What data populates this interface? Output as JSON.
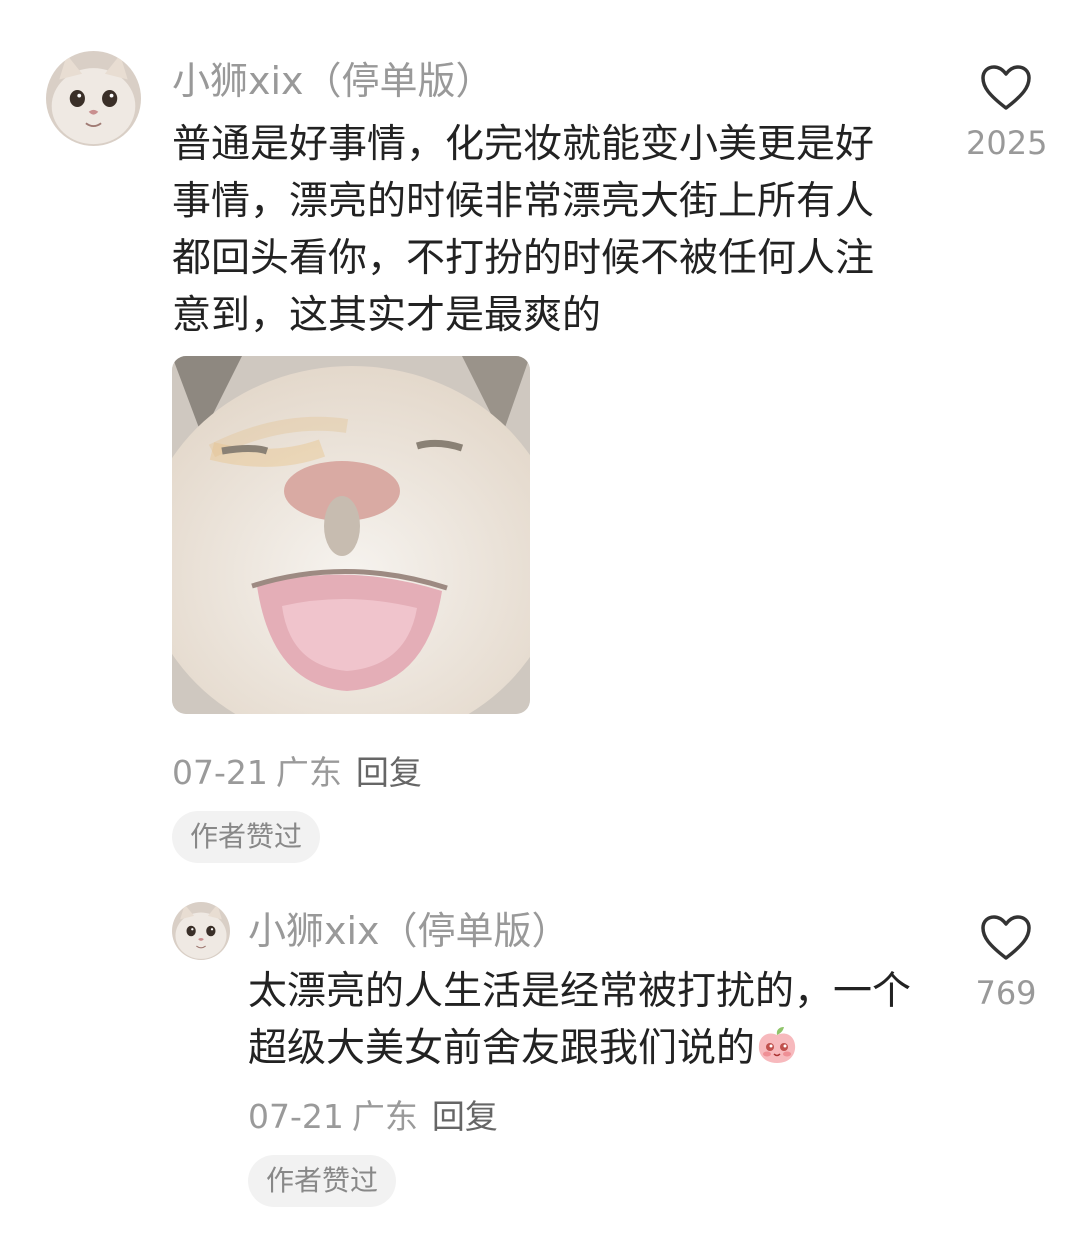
{
  "comments": [
    {
      "username": "小狮xix（停单版）",
      "text": "普通是好事情，化完妆就能变小美更是好事情，漂亮的时候非常漂亮大街上所有人都回头看你，不打扮的时候不被任何人注意到，这其实才是最爽的",
      "date": "07-21",
      "location": "广东",
      "reply_label": "回复",
      "badge": "作者赞过",
      "likes": "2025",
      "avatar_icon": "cat-face-avatar",
      "attachment_icon": "smiling-cat-image"
    },
    {
      "username": "小狮xix（停单版）",
      "text": "太漂亮的人生活是经常被打扰的，一个超级大美女前舍友跟我们说的",
      "emoji_icon": "blushing-peach-emoji",
      "date": "07-21",
      "location": "广东",
      "reply_label": "回复",
      "badge": "作者赞过",
      "likes": "769",
      "avatar_icon": "cat-face-avatar"
    }
  ],
  "colors": {
    "text": "#222222",
    "muted": "#999999",
    "badge_bg": "#f2f2f2"
  }
}
